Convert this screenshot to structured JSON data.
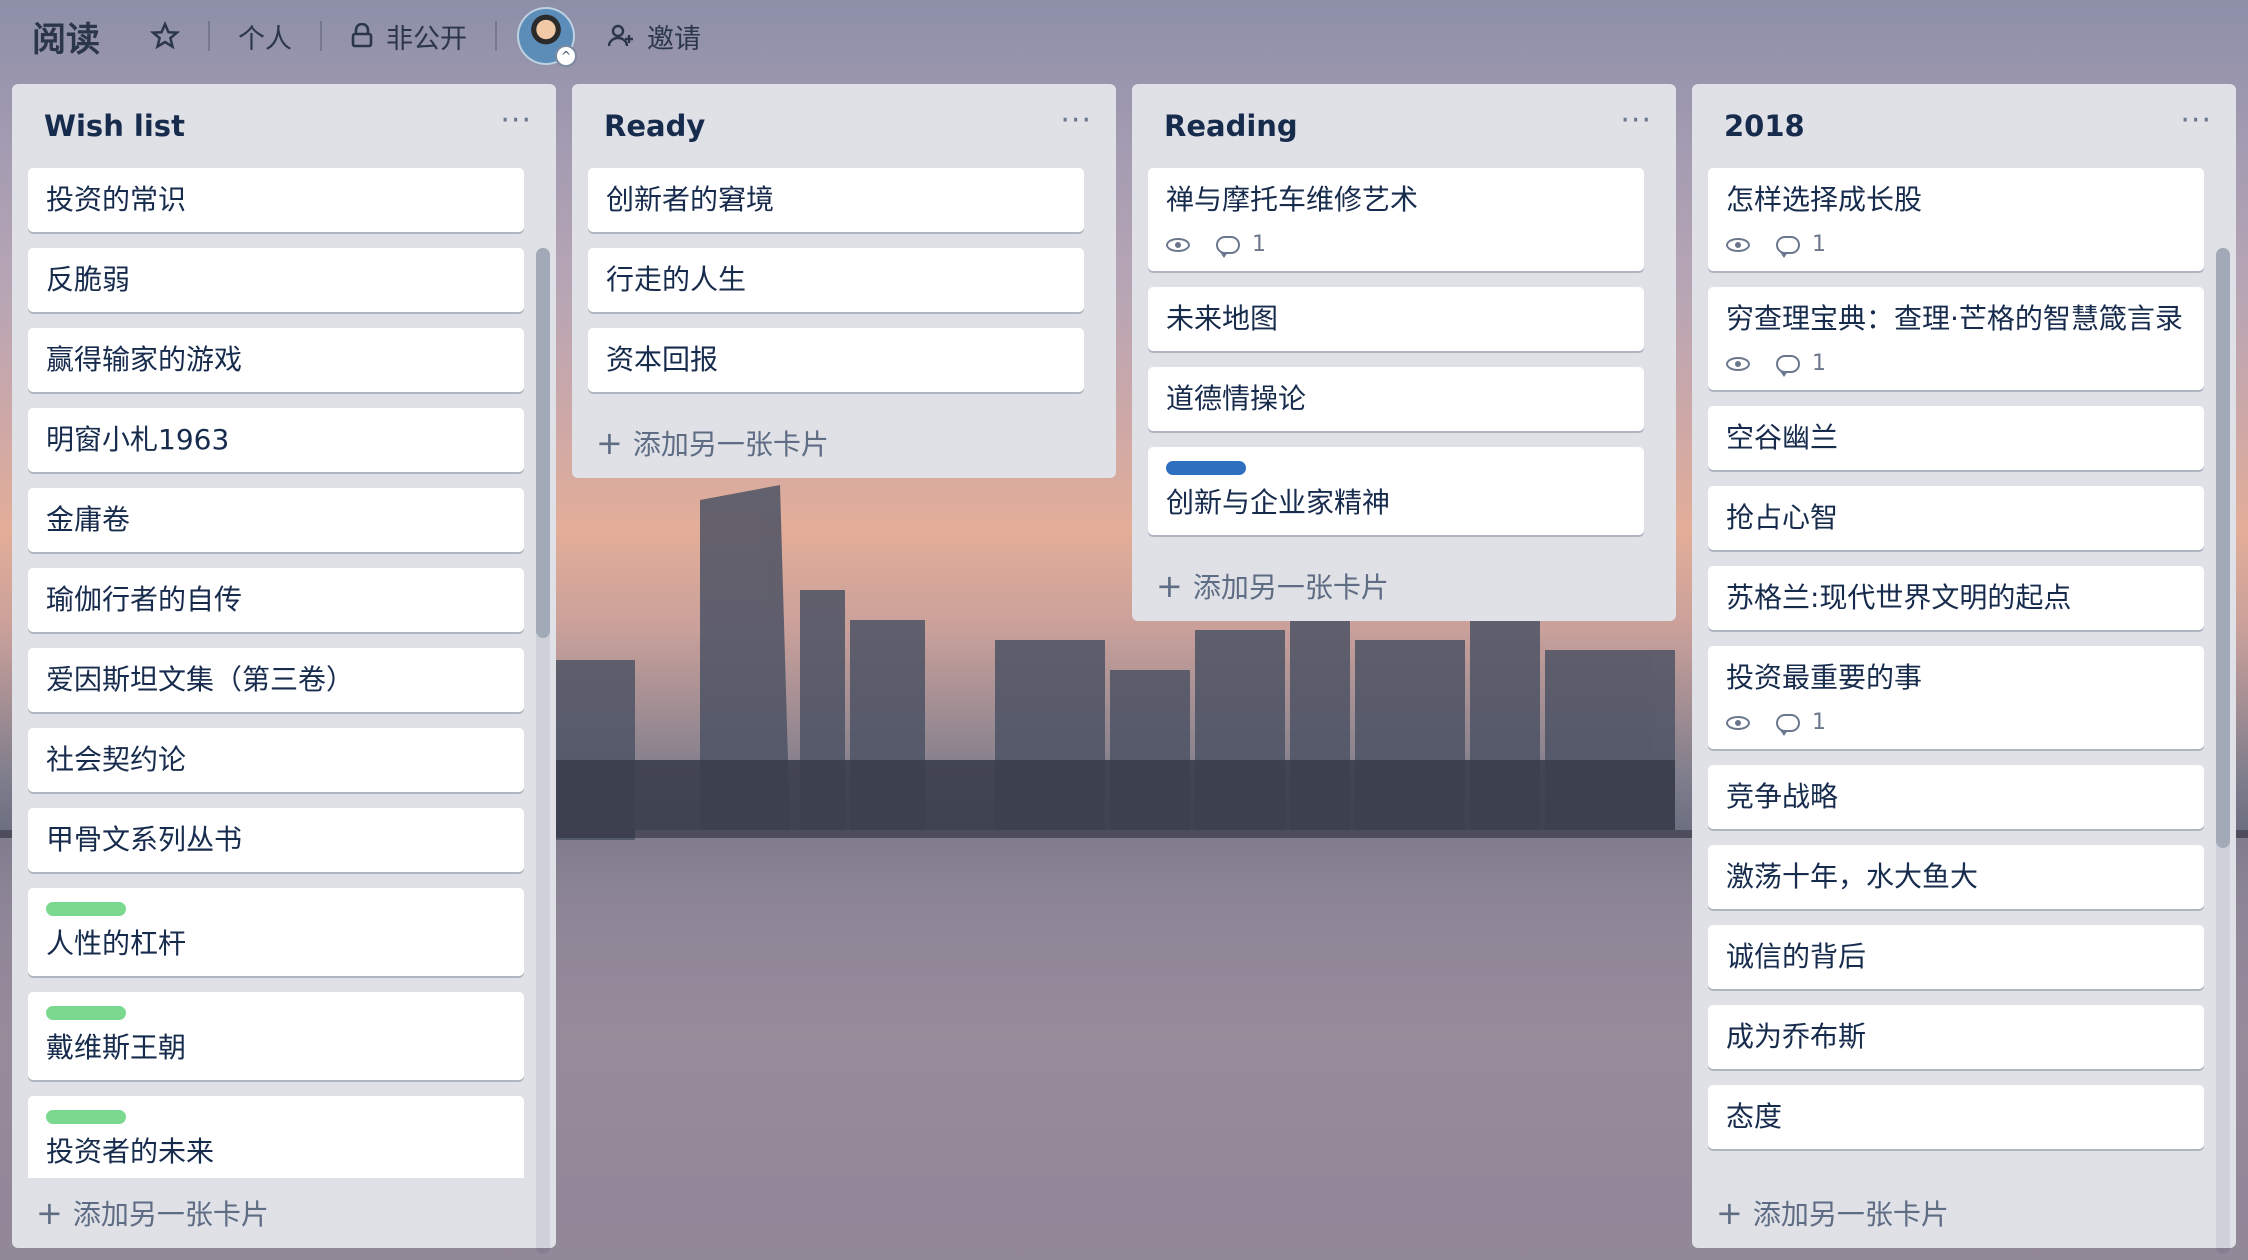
{
  "board": {
    "title": "阅读",
    "visibility_team": "个人",
    "visibility_access": "非公开",
    "invite_label": "邀请"
  },
  "icons": {
    "star": "star-icon",
    "lock": "lock-icon",
    "invite": "add-person-icon",
    "menu": "more-icon",
    "watch": "eye-icon",
    "comment": "comment-icon",
    "add": "plus-icon"
  },
  "colors": {
    "label_green": "#7bd88f",
    "label_blue": "#2f6fbf",
    "list_bg": "#dfe1e6"
  },
  "add_card_label": "添加另一张卡片",
  "lists": [
    {
      "title": "Wish list",
      "cards": [
        {
          "title": "投资的常识"
        },
        {
          "title": "反脆弱"
        },
        {
          "title": "赢得输家的游戏"
        },
        {
          "title": "明窗小札1963"
        },
        {
          "title": "金庸卷"
        },
        {
          "title": "瑜伽行者的自传"
        },
        {
          "title": "爱因斯坦文集（第三卷）"
        },
        {
          "title": "社会契约论"
        },
        {
          "title": "甲骨文系列丛书"
        },
        {
          "title": "人性的杠杆",
          "label": "green"
        },
        {
          "title": "戴维斯王朝",
          "label": "green"
        },
        {
          "title": "投资者的未来",
          "label": "green"
        }
      ]
    },
    {
      "title": "Ready",
      "cards": [
        {
          "title": "创新者的窘境"
        },
        {
          "title": "行走的人生"
        },
        {
          "title": "资本回报"
        }
      ]
    },
    {
      "title": "Reading",
      "cards": [
        {
          "title": "禅与摩托车维修艺术",
          "watch": true,
          "comments": "1"
        },
        {
          "title": "未来地图"
        },
        {
          "title": "道德情操论"
        },
        {
          "title": "创新与企业家精神",
          "label": "blue"
        }
      ]
    },
    {
      "title": "2018",
      "cards": [
        {
          "title": "怎样选择成长股",
          "watch": true,
          "comments": "1"
        },
        {
          "title": "穷查理宝典：查理·芒格的智慧箴言录",
          "watch": true,
          "comments": "1"
        },
        {
          "title": "空谷幽兰"
        },
        {
          "title": "抢占心智"
        },
        {
          "title": "苏格兰:现代世界文明的起点"
        },
        {
          "title": "投资最重要的事",
          "watch": true,
          "comments": "1"
        },
        {
          "title": "竞争战略"
        },
        {
          "title": "激荡十年，水大鱼大"
        },
        {
          "title": "诚信的背后"
        },
        {
          "title": "成为乔布斯"
        },
        {
          "title": "态度"
        }
      ]
    }
  ]
}
